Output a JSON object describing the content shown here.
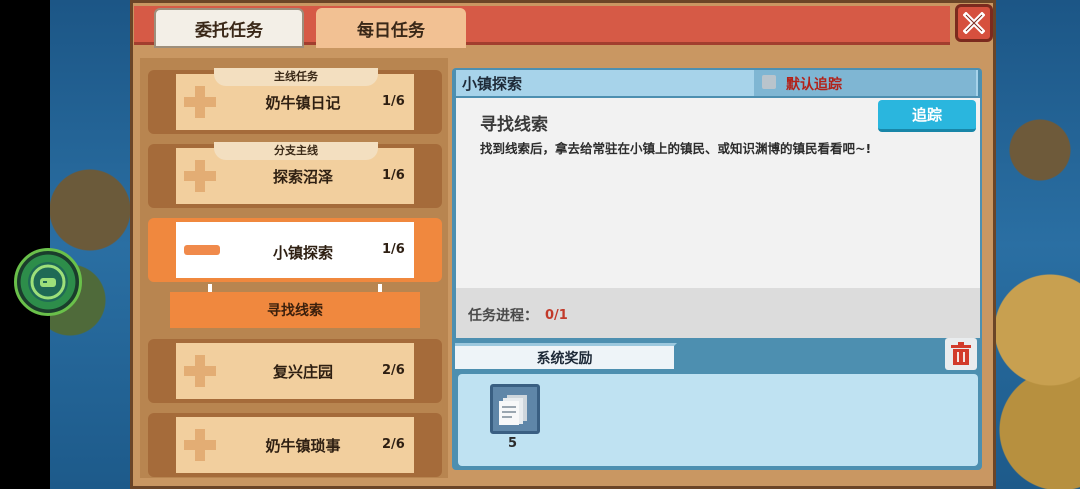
{
  "tabs": {
    "commission": "委托任务",
    "daily": "每日任务"
  },
  "quests": [
    {
      "tag": "主线任务",
      "name": "奶牛镇日记",
      "progress": "1/6"
    },
    {
      "tag": "分支主线",
      "name": "探索沼泽",
      "progress": "1/6"
    },
    {
      "tag": "",
      "name": "小镇探索",
      "progress": "1/6",
      "active": true
    },
    {
      "tag": "",
      "name": "复兴庄园",
      "progress": "2/6"
    },
    {
      "tag": "",
      "name": "奶牛镇琐事",
      "progress": "2/6"
    }
  ],
  "active_subitem": "寻找线索",
  "detail": {
    "header_title": "小镇探索",
    "default_track_label": "默认追踪",
    "task_title": "寻找线索",
    "task_desc": "找到线索后，拿去给常驻在小镇上的镇民、或知识渊博的镇民看看吧~!",
    "track_button": "追踪",
    "progress_label": "任务进程：",
    "progress_value": "0/1",
    "reward_tab": "系统奖励",
    "reward_item_count": "5"
  },
  "icons": {
    "close": "close-icon",
    "trash": "trash-icon",
    "reward": "document-stack-icon",
    "gamepad": "gamepad-icon"
  },
  "colors": {
    "topbar": "#d65a46",
    "active_quest": "#f0883e",
    "track_button": "#2ab6de",
    "progress_value": "#c23a2a"
  }
}
